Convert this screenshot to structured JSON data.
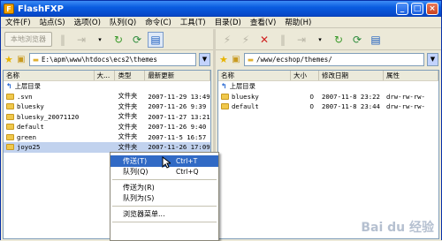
{
  "window": {
    "title": "FlashFXP"
  },
  "menu": [
    "文件(F)",
    "站点(S)",
    "选项(O)",
    "队列(Q)",
    "命令(C)",
    "工具(T)",
    "目录(D)",
    "查看(V)",
    "帮助(H)"
  ],
  "left": {
    "local_button": "本地浏览器",
    "path": "E:\\apm\\www\\htdocs\\ecs2\\themes",
    "columns": [
      "名称",
      "大...",
      "类型",
      "最新更新"
    ],
    "up_label": "上层目录",
    "rows": [
      {
        "name": ".svn",
        "size": "",
        "type": "文件夹",
        "date": "2007-11-29 13:49"
      },
      {
        "name": "bluesky",
        "size": "",
        "type": "文件夹",
        "date": "2007-11-26 9:39"
      },
      {
        "name": "bluesky_20071120",
        "size": "",
        "type": "文件夹",
        "date": "2007-11-27 13:21"
      },
      {
        "name": "default",
        "size": "",
        "type": "文件夹",
        "date": "2007-11-26 9:40"
      },
      {
        "name": "green",
        "size": "",
        "type": "文件夹",
        "date": "2007-11-5 16:57"
      },
      {
        "name": "joyo25",
        "size": "",
        "type": "文件夹",
        "date": "2007-11-26 17:09"
      }
    ]
  },
  "right": {
    "path": "/www/ecshop/themes/",
    "columns": [
      "名称",
      "大小",
      "修改日期",
      "属性"
    ],
    "up_label": "上层目录",
    "rows": [
      {
        "name": "bluesky",
        "size": "0",
        "date": "2007-11-8 23:22",
        "attr": "drw-rw-rw-"
      },
      {
        "name": "default",
        "size": "0",
        "date": "2007-11-8 23:44",
        "attr": "drw-rw-rw-"
      }
    ]
  },
  "context_menu": {
    "items": [
      {
        "label": "传送(T)",
        "shortcut": "Ctrl+T"
      },
      {
        "label": "队列(Q)",
        "shortcut": "Ctrl+Q"
      },
      {
        "label": "传送为(R)",
        "shortcut": ""
      },
      {
        "label": "队列为(S)",
        "shortcut": ""
      },
      {
        "label": "浏览器菜单...",
        "shortcut": ""
      }
    ]
  },
  "watermark": "Bai du 经验",
  "colors": {
    "titlebar": "#0a5ce0",
    "highlight": "#316ac5",
    "selection": "#c1d2ee"
  }
}
